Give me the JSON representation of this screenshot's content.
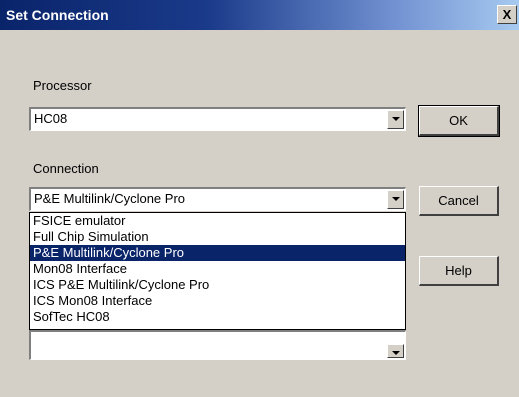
{
  "dialog": {
    "title": "Set Connection",
    "close_symbol": "X"
  },
  "processor": {
    "label": "Processor",
    "value": "HC08"
  },
  "connection": {
    "label": "Connection",
    "value": "P&E Multilink/Cyclone Pro",
    "options": [
      "FSICE emulator",
      "Full Chip Simulation",
      "P&E Multilink/Cyclone Pro",
      "Mon08 Interface",
      "ICS P&E Multilink/Cyclone Pro",
      "ICS Mon08 Interface",
      "SofTec HC08"
    ],
    "selected_index": 2
  },
  "buttons": {
    "ok": "OK",
    "cancel": "Cancel",
    "help": "Help"
  },
  "colors": {
    "dialog_bg": "#d4d0c8",
    "titlebar_start": "#0a246a",
    "titlebar_end": "#a6caf0",
    "selection_bg": "#0a246a"
  }
}
